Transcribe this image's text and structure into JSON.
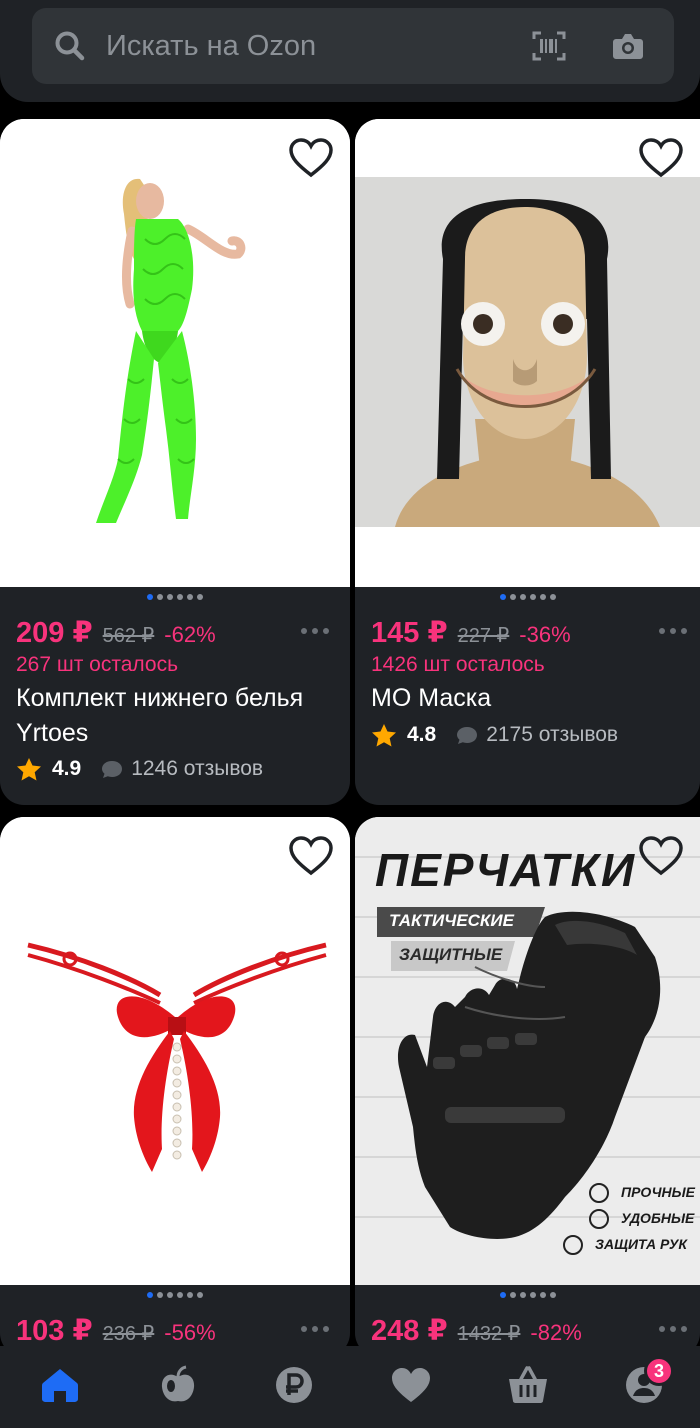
{
  "search": {
    "placeholder": "Искать на Ozon"
  },
  "products": [
    {
      "price": "209 ₽",
      "old_price": "562 ₽",
      "discount": "-62%",
      "stock_left": "267 шт осталось",
      "title": "Комплект нижнего белья Yrtoes",
      "rating": "4.9",
      "reviews": "1246 отзывов",
      "image": "lingerie-bodystocking-green"
    },
    {
      "price": "145 ₽",
      "old_price": "227 ₽",
      "discount": "-36%",
      "stock_left": "1426 шт осталось",
      "title": "МО Маска",
      "rating": "4.8",
      "reviews": "2175 отзывов",
      "image": "momo-mask"
    },
    {
      "price": "103 ₽",
      "old_price": "236 ₽",
      "discount": "-56%",
      "image": "red-bow-underwear"
    },
    {
      "price": "248 ₽",
      "old_price": "1432 ₽",
      "discount": "-82%",
      "image": "tactical-gloves",
      "image_text": {
        "headline": "ПЕРЧАТКИ",
        "tag1": "ТАКТИЧЕСКИЕ",
        "tag2": "ЗАЩИТНЫЕ",
        "feature1": "ПРОЧНЫЕ",
        "feature2": "УДОБНЫЕ",
        "feature3": "ЗАЩИТА РУК"
      }
    }
  ],
  "nav": {
    "items": [
      "home-icon",
      "fresh-icon",
      "ruble-icon",
      "favorites-icon",
      "cart-icon",
      "profile-icon"
    ],
    "profile_badge": "3"
  },
  "colors": {
    "accent_pink": "#f8337c",
    "active_blue": "#1e6cf5",
    "card_bg": "#1f2226"
  }
}
